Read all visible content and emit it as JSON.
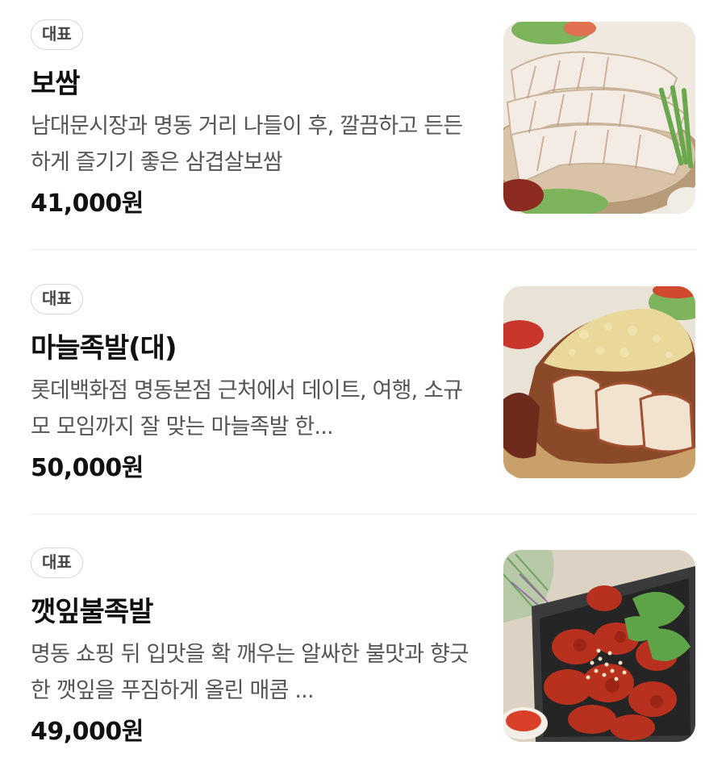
{
  "menu": {
    "items": [
      {
        "badge": "대표",
        "name": "보쌈",
        "description": "남대문시장과 명동 거리 나들이 후, 깔끔하고 든든하게 즐기기 좋은 삼겹살보쌈",
        "price": "41,000원",
        "image": "bossam-photo"
      },
      {
        "badge": "대표",
        "name": "마늘족발(대)",
        "description": "롯데백화점 명동본점 근처에서 데이트, 여행, 소규모 모임까지 잘 맞는 마늘족발 한...",
        "price": "50,000원",
        "image": "garlic-jokbal-photo"
      },
      {
        "badge": "대표",
        "name": "깻잎불족발",
        "description": "명동 쇼핑 뒤 입맛을 확 깨우는 알싸한 불맛과 향긋한 깻잎을 푸짐하게 올린 매콤 ...",
        "price": "49,000원",
        "image": "spicy-perilla-jokbal-photo"
      }
    ]
  }
}
